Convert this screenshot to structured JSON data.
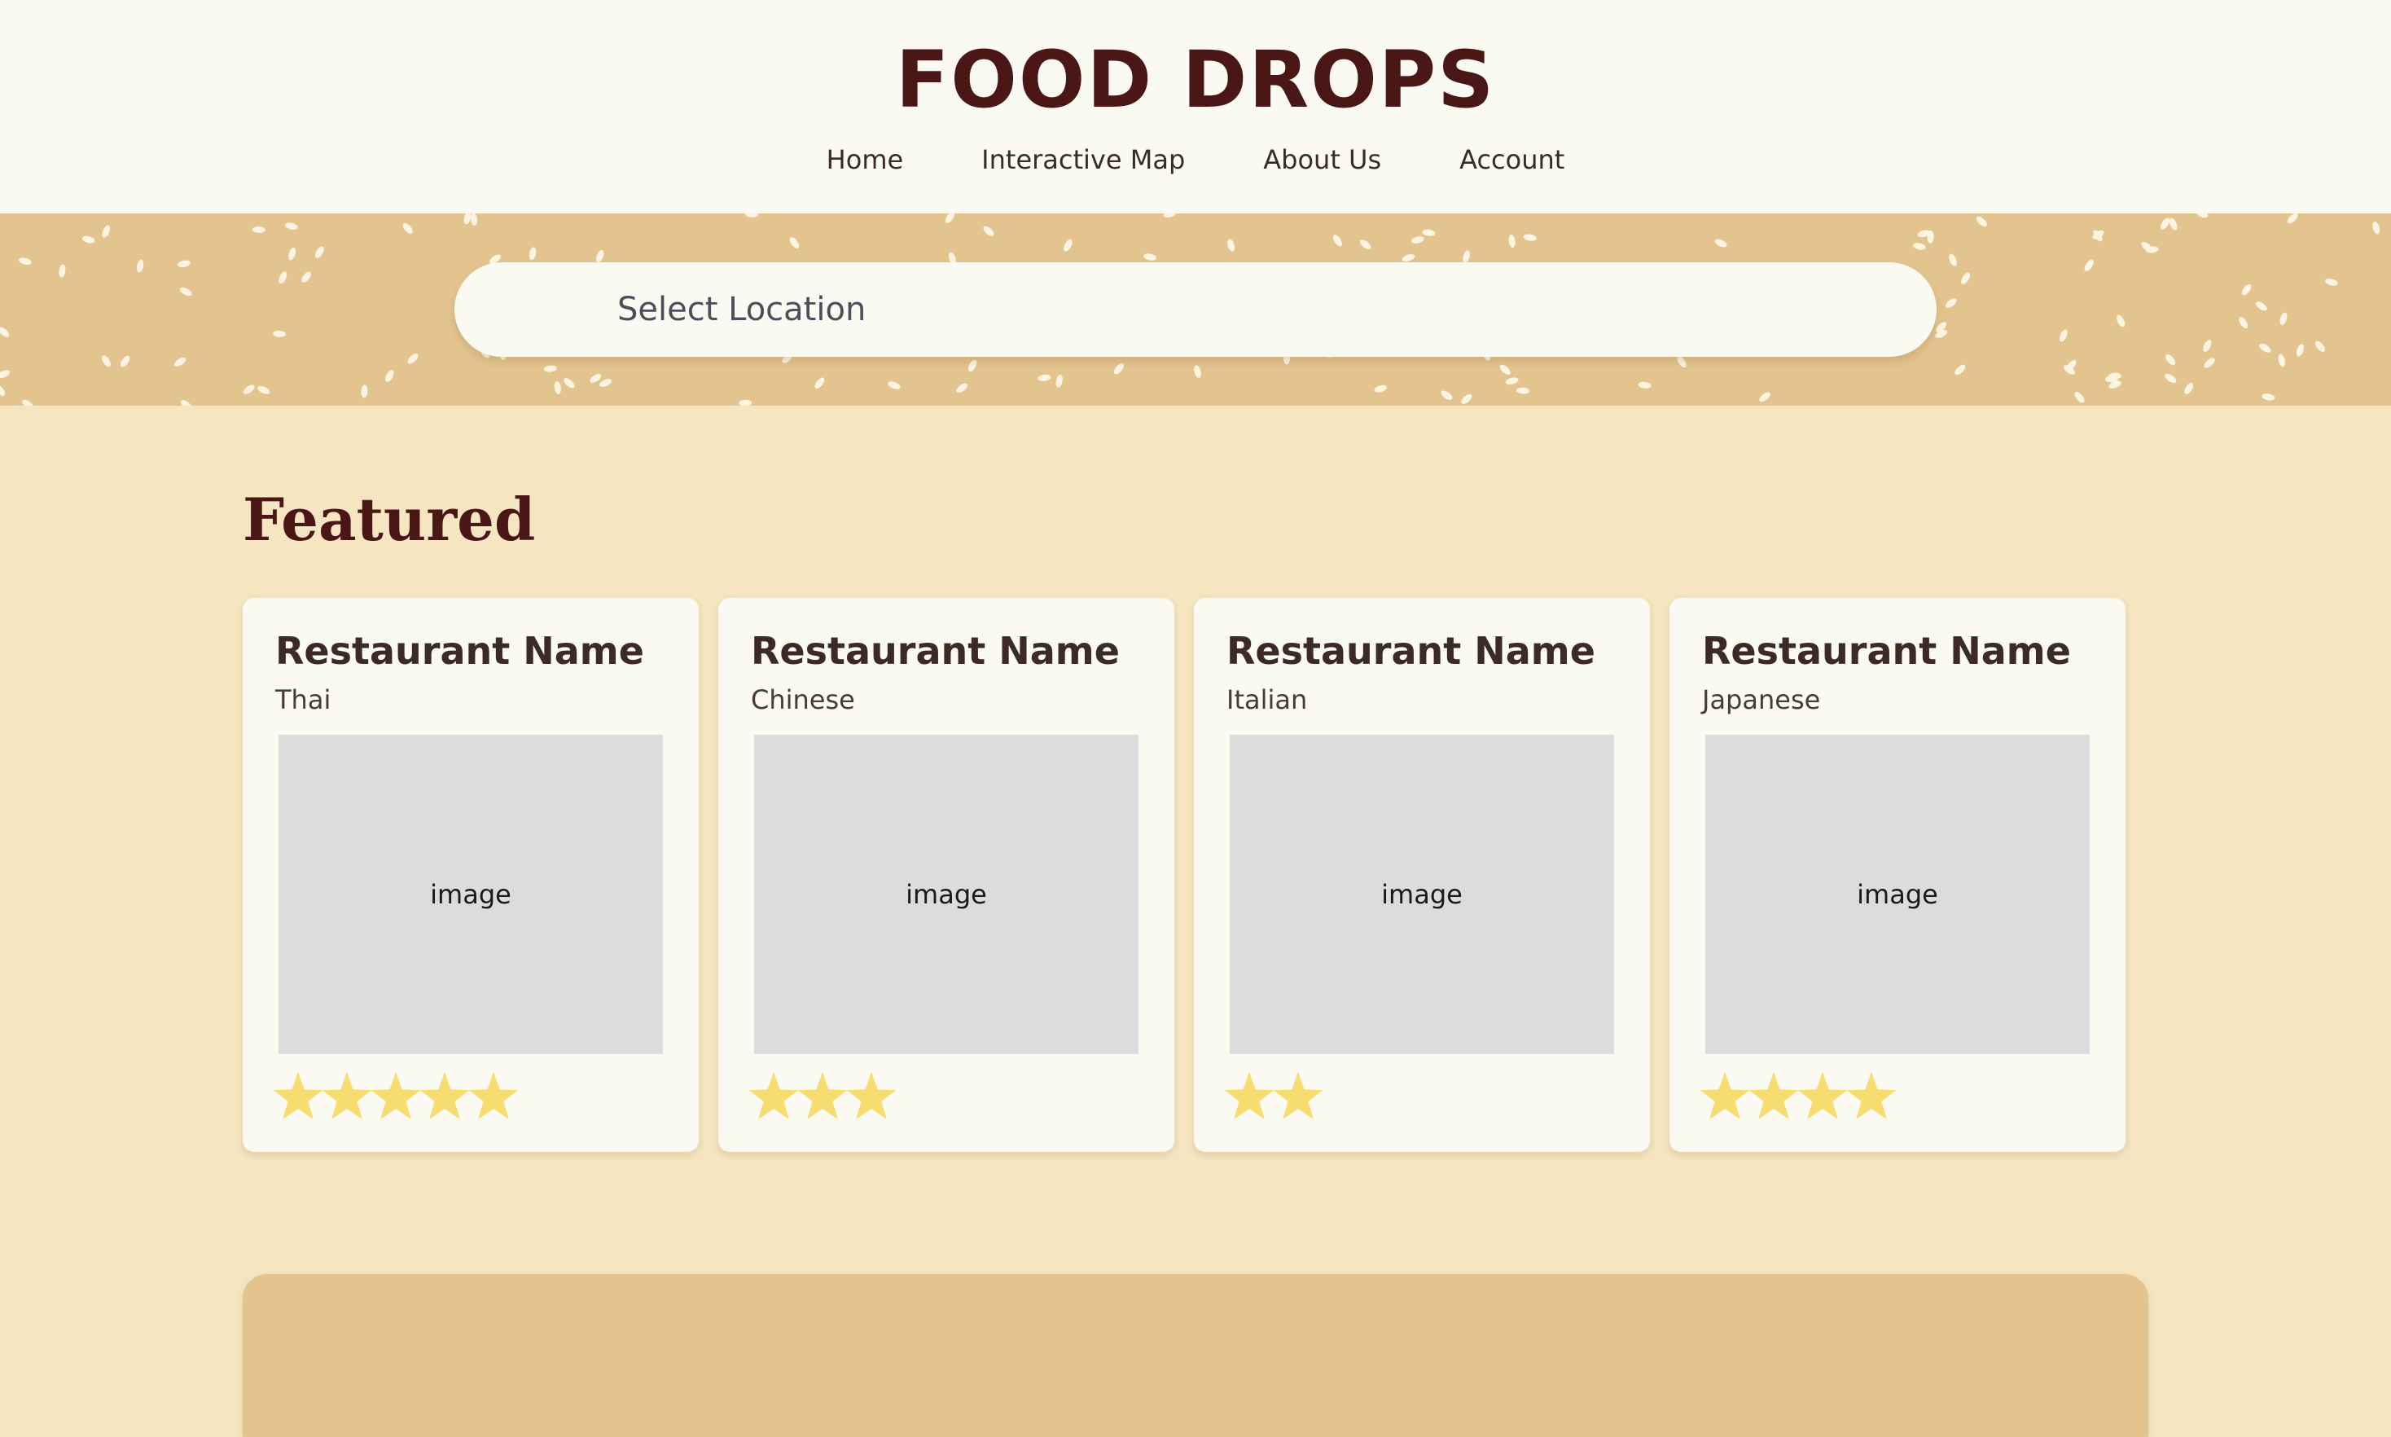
{
  "header": {
    "brand": "FOOD DROPS",
    "nav": [
      "Home",
      "Interactive Map",
      "About Us",
      "Account"
    ]
  },
  "search": {
    "placeholder": "Select Location"
  },
  "featured": {
    "title": "Featured",
    "cards": [
      {
        "name": "Restaurant Name",
        "cuisine": "Thai",
        "image_label": "image",
        "rating": 5
      },
      {
        "name": "Restaurant Name",
        "cuisine": "Chinese",
        "image_label": "image",
        "rating": 3
      },
      {
        "name": "Restaurant Name",
        "cuisine": "Italian",
        "image_label": "image",
        "rating": 2
      },
      {
        "name": "Restaurant Name",
        "cuisine": "Japanese",
        "image_label": "image",
        "rating": 4
      }
    ]
  },
  "colors": {
    "brand": "#4a1716",
    "header_bg": "#fafaf2",
    "banner_bg": "#e3c48e",
    "page_bg": "#f5e6c1",
    "star": "#f7dc6f"
  },
  "icons": {
    "star": "star-icon"
  }
}
